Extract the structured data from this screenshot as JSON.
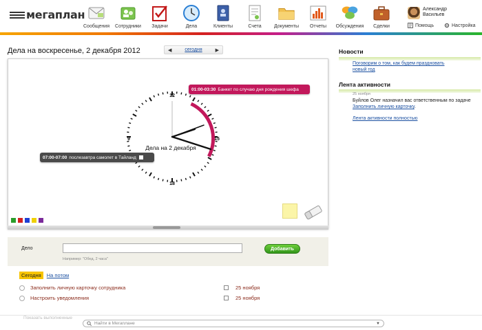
{
  "app": {
    "logo_text": "мегаплан"
  },
  "nav": [
    {
      "key": "messages",
      "label": "Сообщения",
      "icon": "messages-icon"
    },
    {
      "key": "employees",
      "label": "Сотрудники",
      "icon": "employees-icon"
    },
    {
      "key": "tasks",
      "label": "Задачи",
      "icon": "tasks-icon"
    },
    {
      "key": "deals",
      "label": "Дела",
      "icon": "clock-icon"
    },
    {
      "key": "clients",
      "label": "Клиенты",
      "icon": "clients-book-icon"
    },
    {
      "key": "invoices",
      "label": "Счета",
      "icon": "invoice-icon"
    },
    {
      "key": "documents",
      "label": "Документы",
      "icon": "folder-icon"
    },
    {
      "key": "reports",
      "label": "Отчеты",
      "icon": "reports-chart-icon"
    },
    {
      "key": "discussions",
      "label": "Обсуждения",
      "icon": "discussion-bubbles-icon"
    },
    {
      "key": "deals2",
      "label": "Сделки",
      "icon": "briefcase-icon"
    }
  ],
  "user": {
    "name_line1": "Александр",
    "name_line2": "Васильев",
    "help": "Помощь",
    "settings": "Настройка"
  },
  "header": {
    "title": "Дела на воскресенье, 2 декабря 2012",
    "prev": "◀",
    "today": "сегодня",
    "next": "▶"
  },
  "clock": {
    "center_label": "Дела на 2 декабря",
    "hour_labels": {
      "top": "12",
      "right": "15",
      "bottom": "18",
      "left": "9"
    },
    "events": [
      {
        "time": "01:00-03:30",
        "title": "Банкет по случаю дня рождения шефа",
        "color": "#c2185b"
      },
      {
        "time": "07:00-07:00",
        "title": "послезавтра самолет в Тайланд",
        "color": "#4a4a4a"
      }
    ]
  },
  "palette": [
    "#2a9d2a",
    "#d42020",
    "#1e3fd4",
    "#f0d000",
    "#7a2a9a"
  ],
  "sticky_color": "#fbf5a8",
  "add_form": {
    "label": "Дело",
    "value": "",
    "placeholder": "",
    "hint": "Например: \"Обед, 2 часа\"",
    "button": "Добавить"
  },
  "tabs": {
    "today": "Сегодня",
    "later": "На потом"
  },
  "tasks_left": [
    {
      "title": "Заполнить личную карточку сотрудника"
    },
    {
      "title": "Настроить уведомления"
    }
  ],
  "tasks_right": [
    {
      "date": "25 ноября"
    },
    {
      "date": "25 ноября"
    }
  ],
  "faded_text": "Показать выполненные",
  "search": {
    "placeholder": "Найти в Мегаплане"
  },
  "sidebar": {
    "news_title": "Новости",
    "news_link_line1": "Поговорим о том, как будем праздновать",
    "news_link_line2": "новый год",
    "activity_title": "Лента активности",
    "activity_date": "25 ноября",
    "activity_text": "Буйлов Олег назначил вас ответственным по задаче",
    "activity_task": "Заполнить личную карточку",
    "activity_all": "Лента активности полностью"
  }
}
